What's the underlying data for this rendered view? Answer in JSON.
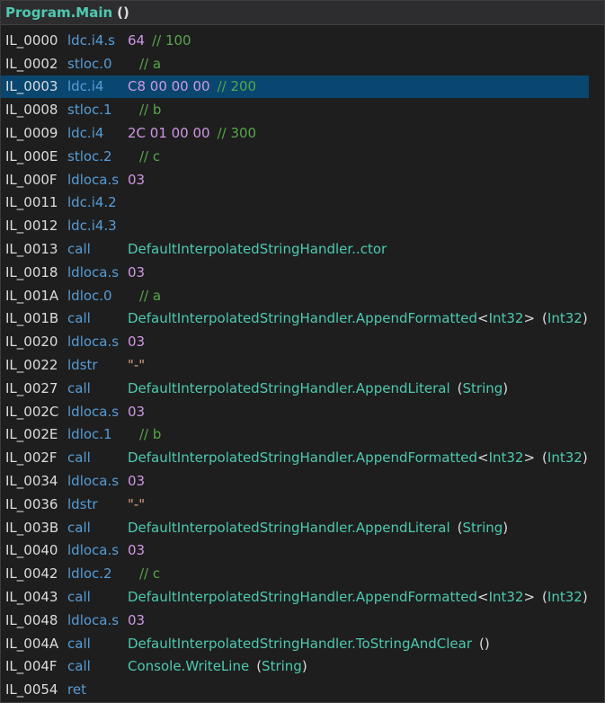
{
  "header": {
    "method": "Program.Main",
    "parens": "()"
  },
  "rows": [
    {
      "label": "IL_0000",
      "opcode": "ldc.i4.s",
      "num": "64",
      "comment": "// 100"
    },
    {
      "label": "IL_0002",
      "opcode": "stloc.0",
      "var_comment": "// a"
    },
    {
      "label": "IL_0003",
      "opcode": "ldc.i4",
      "hex": "C8 00 00 00",
      "comment": "// 200",
      "selected": true
    },
    {
      "label": "IL_0008",
      "opcode": "stloc.1",
      "var_comment": "// b"
    },
    {
      "label": "IL_0009",
      "opcode": "ldc.i4",
      "hex": "2C 01 00 00",
      "comment": "// 300"
    },
    {
      "label": "IL_000E",
      "opcode": "stloc.2",
      "var_comment": "// c"
    },
    {
      "label": "IL_000F",
      "opcode": "ldloca.s",
      "num": "03"
    },
    {
      "label": "IL_0011",
      "opcode": "ldc.i4.2"
    },
    {
      "label": "IL_0012",
      "opcode": "ldc.i4.3"
    },
    {
      "label": "IL_0013",
      "opcode": "call",
      "target": "DefaultInterpolatedStringHandler..ctor"
    },
    {
      "label": "IL_0018",
      "opcode": "ldloca.s",
      "num": "03"
    },
    {
      "label": "IL_001A",
      "opcode": "ldloc.0",
      "var_comment": "// a"
    },
    {
      "label": "IL_001B",
      "opcode": "call",
      "target": "DefaultInterpolatedStringHandler.AppendFormatted",
      "generic_open": "<",
      "generic_type": "Int32",
      "generic_close": ">",
      "sig_open": "(",
      "sig_type": "Int32",
      "sig_close": ")"
    },
    {
      "label": "IL_0020",
      "opcode": "ldloca.s",
      "num": "03"
    },
    {
      "label": "IL_0022",
      "opcode": "ldstr",
      "str": "\"-\""
    },
    {
      "label": "IL_0027",
      "opcode": "call",
      "target": "DefaultInterpolatedStringHandler.AppendLiteral",
      "sig_open": "(",
      "sig_type": "String",
      "sig_close": ")"
    },
    {
      "label": "IL_002C",
      "opcode": "ldloca.s",
      "num": "03"
    },
    {
      "label": "IL_002E",
      "opcode": "ldloc.1",
      "var_comment": "// b"
    },
    {
      "label": "IL_002F",
      "opcode": "call",
      "target": "DefaultInterpolatedStringHandler.AppendFormatted",
      "generic_open": "<",
      "generic_type": "Int32",
      "generic_close": ">",
      "sig_open": "(",
      "sig_type": "Int32",
      "sig_close": ")"
    },
    {
      "label": "IL_0034",
      "opcode": "ldloca.s",
      "num": "03"
    },
    {
      "label": "IL_0036",
      "opcode": "ldstr",
      "str": "\"-\""
    },
    {
      "label": "IL_003B",
      "opcode": "call",
      "target": "DefaultInterpolatedStringHandler.AppendLiteral",
      "sig_open": "(",
      "sig_type": "String",
      "sig_close": ")"
    },
    {
      "label": "IL_0040",
      "opcode": "ldloca.s",
      "num": "03"
    },
    {
      "label": "IL_0042",
      "opcode": "ldloc.2",
      "var_comment": "// c"
    },
    {
      "label": "IL_0043",
      "opcode": "call",
      "target": "DefaultInterpolatedStringHandler.AppendFormatted",
      "generic_open": "<",
      "generic_type": "Int32",
      "generic_close": ">",
      "sig_open": "(",
      "sig_type": "Int32",
      "sig_close": ")"
    },
    {
      "label": "IL_0048",
      "opcode": "ldloca.s",
      "num": "03"
    },
    {
      "label": "IL_004A",
      "opcode": "call",
      "target": "DefaultInterpolatedStringHandler.ToStringAndClear",
      "sig_open": "(",
      "sig_close": ")"
    },
    {
      "label": "IL_004F",
      "opcode": "call",
      "target": "Console.WriteLine",
      "sig_open": "(",
      "sig_type": "String",
      "sig_close": ")"
    },
    {
      "label": "IL_0054",
      "opcode": "ret"
    }
  ]
}
